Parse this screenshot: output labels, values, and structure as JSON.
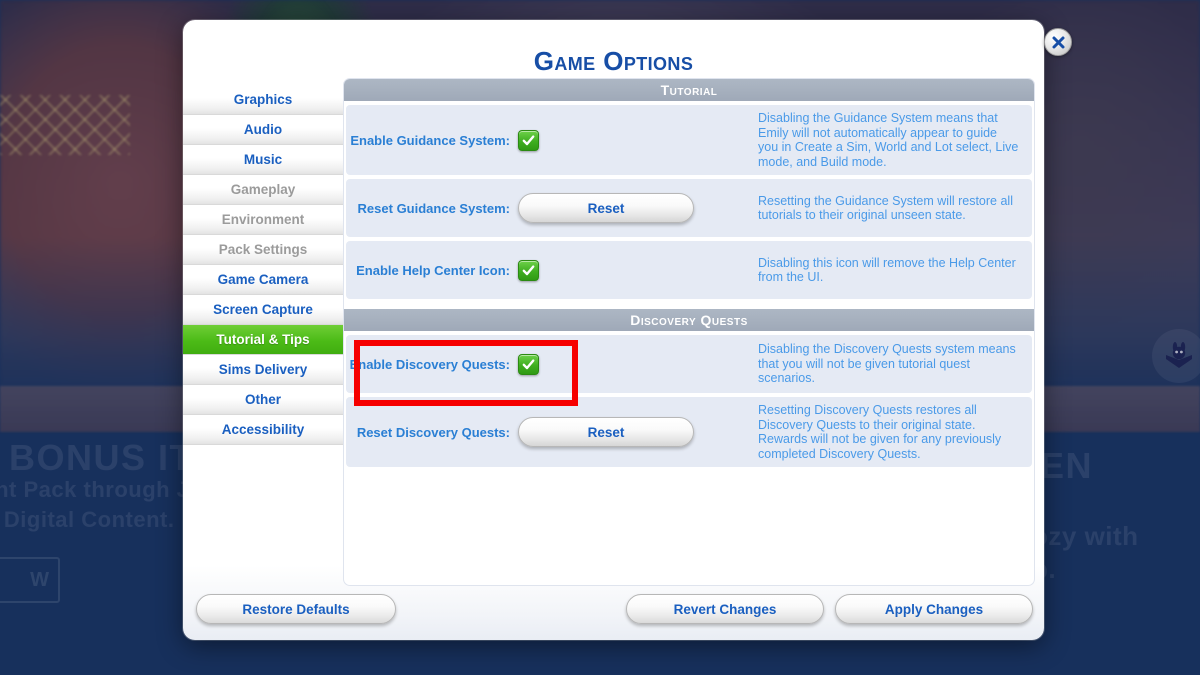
{
  "background": {
    "promo_left_title": "E BONUS IT",
    "promo_left_line1": "Rent Pack through Ja",
    "promo_left_line2": "ats Digital Content.",
    "promo_left_button": "W",
    "promo_right_title": "EN",
    "promo_right_line1": "ozy with",
    "promo_right_line2": "p.",
    "badge_icon": "bunny-in-box-icon"
  },
  "dialog": {
    "title": "Game Options",
    "close_icon": "close-icon"
  },
  "sidebar": {
    "items": [
      {
        "label": "Graphics",
        "state": "enabled"
      },
      {
        "label": "Audio",
        "state": "enabled"
      },
      {
        "label": "Music",
        "state": "enabled"
      },
      {
        "label": "Gameplay",
        "state": "disabled"
      },
      {
        "label": "Environment",
        "state": "disabled"
      },
      {
        "label": "Pack Settings",
        "state": "disabled"
      },
      {
        "label": "Game Camera",
        "state": "enabled"
      },
      {
        "label": "Screen Capture",
        "state": "enabled"
      },
      {
        "label": "Tutorial & Tips",
        "state": "active"
      },
      {
        "label": "Sims Delivery",
        "state": "enabled"
      },
      {
        "label": "Other",
        "state": "enabled"
      },
      {
        "label": "Accessibility",
        "state": "enabled"
      }
    ]
  },
  "sections": [
    {
      "header": "Tutorial",
      "rows": [
        {
          "label": "Enable Guidance System:",
          "control": "checkbox",
          "checked": true,
          "description": "Disabling the Guidance System means that Emily will not automatically appear to guide you in Create a Sim, World and Lot select, Live mode, and Build mode."
        },
        {
          "label": "Reset Guidance System:",
          "control": "button",
          "button_label": "Reset",
          "description": "Resetting the Guidance System will restore all tutorials to their original unseen state."
        },
        {
          "label": "Enable Help Center Icon:",
          "control": "checkbox",
          "checked": true,
          "description": "Disabling this icon will remove the Help Center from the UI."
        }
      ]
    },
    {
      "header": "Discovery Quests",
      "rows": [
        {
          "label": "Enable Discovery Quests:",
          "control": "checkbox",
          "checked": true,
          "description": "Disabling the Discovery Quests system means that you will not be given tutorial quest scenarios."
        },
        {
          "label": "Reset Discovery Quests:",
          "control": "button",
          "button_label": "Reset",
          "description": "Resetting Discovery Quests restores all Discovery Quests to their original state. Rewards will not be given for any previously completed Discovery Quests."
        }
      ]
    }
  ],
  "footer": {
    "restore_defaults": "Restore Defaults",
    "revert_changes": "Revert Changes",
    "apply_changes": "Apply Changes"
  },
  "annotation": {
    "highlight_color": "#f60000",
    "highlight_target": "Enable Discovery Quests"
  },
  "colors": {
    "title_blue": "#174ea6",
    "label_blue": "#2a7fd4",
    "description_blue": "#4a9ae8",
    "active_nav_green": "#4cbb17",
    "section_header_gray": "#a3aebd",
    "row_bg": "#e5eaf4",
    "backdrop_navy": "#17305c"
  }
}
